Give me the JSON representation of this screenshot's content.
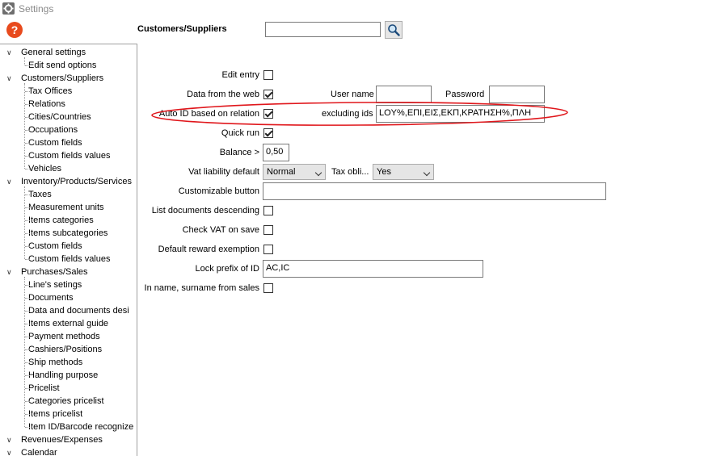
{
  "window": {
    "title": "Settings",
    "icon": "gear-icon"
  },
  "help": {
    "icon": "question-icon",
    "glyph": "?"
  },
  "header": {
    "label": "Customers/Suppliers",
    "search_value": "",
    "search_icon": "magnifier-icon"
  },
  "tree": [
    {
      "label": "General settings",
      "level": 0
    },
    {
      "label": "Edit send options",
      "level": 1
    },
    {
      "label": "Customers/Suppliers",
      "level": 0
    },
    {
      "label": "Tax Offices",
      "level": 1
    },
    {
      "label": "Relations",
      "level": 1
    },
    {
      "label": "Cities/Countries",
      "level": 1
    },
    {
      "label": "Occupations",
      "level": 1
    },
    {
      "label": "Custom fields",
      "level": 1
    },
    {
      "label": "Custom fields values",
      "level": 1
    },
    {
      "label": "Vehicles",
      "level": 1
    },
    {
      "label": "Inventory/Products/Services",
      "level": 0
    },
    {
      "label": "Taxes",
      "level": 1
    },
    {
      "label": "Measurement units",
      "level": 1
    },
    {
      "label": "Items categories",
      "level": 1
    },
    {
      "label": "Items subcategories",
      "level": 1
    },
    {
      "label": "Custom fields",
      "level": 1
    },
    {
      "label": "Custom fields values",
      "level": 1
    },
    {
      "label": "Purchases/Sales",
      "level": 0
    },
    {
      "label": "Line's setings",
      "level": 1
    },
    {
      "label": "Documents",
      "level": 1
    },
    {
      "label": "Data and documents desi",
      "level": 1
    },
    {
      "label": "Items external guide",
      "level": 1
    },
    {
      "label": "Payment methods",
      "level": 1
    },
    {
      "label": "Cashiers/Positions",
      "level": 1
    },
    {
      "label": "Ship methods",
      "level": 1
    },
    {
      "label": "Handling purpose",
      "level": 1
    },
    {
      "label": "Pricelist",
      "level": 1
    },
    {
      "label": "Categories pricelist",
      "level": 1
    },
    {
      "label": "Items pricelist",
      "level": 1
    },
    {
      "label": "Item ID/Barcode recognize",
      "level": 1
    },
    {
      "label": "Revenues/Expenses",
      "level": 0
    },
    {
      "label": "Calendar",
      "level": 0
    }
  ],
  "form": {
    "edit_entry": {
      "label": "Edit entry",
      "checked": false
    },
    "data_from_web": {
      "label": "Data from the web",
      "checked": true
    },
    "user_name": {
      "label": "User name",
      "value": ""
    },
    "password": {
      "label": "Password",
      "value": ""
    },
    "auto_id": {
      "label": "Auto ID based on relation",
      "checked": true
    },
    "excluding_ids": {
      "label": "excluding ids",
      "value": "LOY%,ΕΠΙ,ΕΙΣ,ΕΚΠ,ΚΡΑΤΗΣΗ%,ΠΛΗ"
    },
    "quick_run": {
      "label": "Quick run",
      "checked": true
    },
    "balance": {
      "label": "Balance >",
      "value": "0,50"
    },
    "vat_liability": {
      "label": "Vat liability default",
      "value": "Normal"
    },
    "tax_obligation": {
      "label": "Tax obli...",
      "value": "Yes"
    },
    "customizable_button": {
      "label": "Customizable button",
      "value": ""
    },
    "list_docs_desc": {
      "label": "List documents descending",
      "checked": false
    },
    "check_vat": {
      "label": "Check VAT on save",
      "checked": false
    },
    "default_reward": {
      "label": "Default reward exemption",
      "checked": false
    },
    "lock_prefix": {
      "label": "Lock prefix of ID",
      "value": "AC,IC"
    },
    "in_name_surname": {
      "label": "In name, surname from sales",
      "checked": false
    }
  },
  "annotation": {
    "color": "#e0161b"
  }
}
